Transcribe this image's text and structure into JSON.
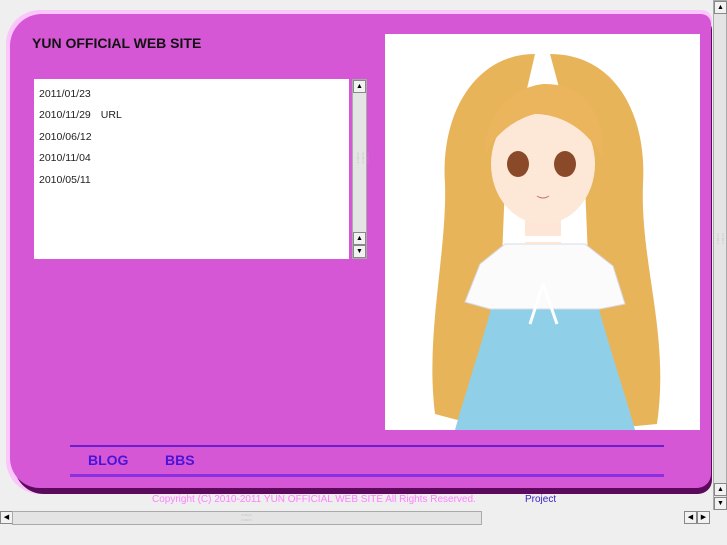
{
  "site_title": "YUN OFFICIAL WEB SITE",
  "news": [
    {
      "date": "2011/01/23",
      "text": ""
    },
    {
      "date": "2010/11/29",
      "text": "URL"
    },
    {
      "date": "2010/06/12",
      "text": ""
    },
    {
      "date": "2010/11/04",
      "text": ""
    },
    {
      "date": "2010/05/11",
      "text": ""
    }
  ],
  "nav": {
    "blog": "BLOG",
    "bbs": "BBS"
  },
  "footer": {
    "copyright": "Copyright (C) 2010-2011 YUN OFFICIAL WEB SITE All Rights Reserved.",
    "project": "Project"
  },
  "colors": {
    "panel": "#d657d6",
    "nav": "#4a14d8",
    "footer": "#ff80ff"
  }
}
